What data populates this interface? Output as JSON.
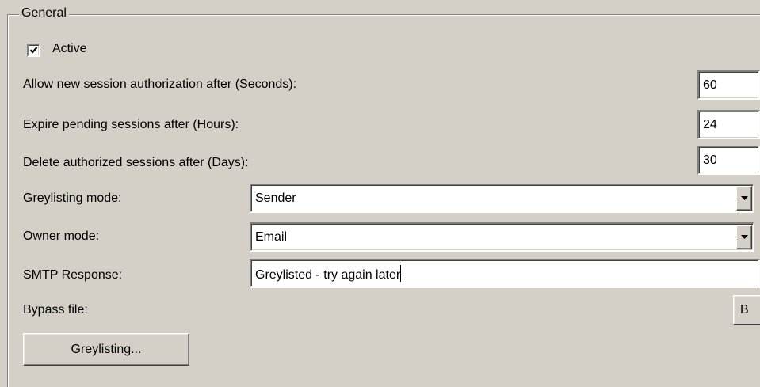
{
  "general": {
    "group_title": "General",
    "active": {
      "label": "Active",
      "checked": true
    },
    "allow_new_session": {
      "label": "Allow new session authorization after (Seconds):",
      "value": "60"
    },
    "expire_pending": {
      "label": "Expire pending sessions after (Hours):",
      "value": "24"
    },
    "delete_authorized": {
      "label": "Delete authorized sessions after (Days):",
      "value": "30"
    },
    "greylisting_mode": {
      "label": "Greylisting mode:",
      "selected": "Sender"
    },
    "owner_mode": {
      "label": "Owner mode:",
      "selected": "Email"
    },
    "smtp_response": {
      "label": "SMTP Response:",
      "value": "Greylisted - try again later"
    },
    "bypass_file": {
      "label": "Bypass file:",
      "browse_label": "B"
    },
    "greylisting_button": {
      "label": "Greylisting..."
    }
  },
  "icons": {
    "checkmark": "checkmark-icon",
    "dropdown": "chevron-down-icon"
  },
  "colors": {
    "background": "#d4d0c8",
    "field": "#ffffff",
    "shadow": "#808080",
    "highlight": "#ffffff"
  }
}
